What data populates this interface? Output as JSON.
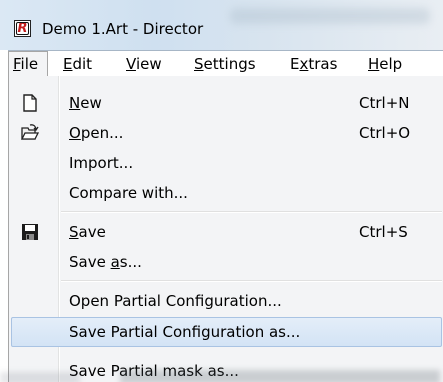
{
  "window": {
    "title": "Demo 1.Art - Director",
    "app_icon": "r-app-icon"
  },
  "menubar": {
    "file": {
      "mn": "F",
      "rest": "ile"
    },
    "edit": {
      "mn": "E",
      "rest": "dit"
    },
    "view": {
      "mn": "V",
      "rest": "iew"
    },
    "settings": {
      "mn": "S",
      "rest": "ettings"
    },
    "extras": {
      "pre": "E",
      "mn": "x",
      "rest": "tras"
    },
    "help": {
      "mn": "H",
      "rest": "elp"
    }
  },
  "file_menu": {
    "new": {
      "mn": "N",
      "rest": "ew",
      "shortcut": "Ctrl+N",
      "icon": "new-document-icon"
    },
    "open": {
      "mn": "O",
      "rest": "pen...",
      "shortcut": "Ctrl+O",
      "icon": "open-folder-icon"
    },
    "import": {
      "label": "Import..."
    },
    "compare": {
      "label": "Compare with..."
    },
    "save": {
      "mn": "S",
      "rest": "ave",
      "shortcut": "Ctrl+S",
      "icon": "floppy-disk-icon"
    },
    "save_as": {
      "pre": "Save ",
      "mn": "a",
      "rest": "s..."
    },
    "open_partial": {
      "label": "Open Partial Configuration..."
    },
    "save_partial": {
      "label": "Save Partial Configuration as..."
    },
    "save_partial_mask": {
      "label": "Save Partial mask as..."
    }
  },
  "highlighted_item": "Save Partial Configuration as..."
}
